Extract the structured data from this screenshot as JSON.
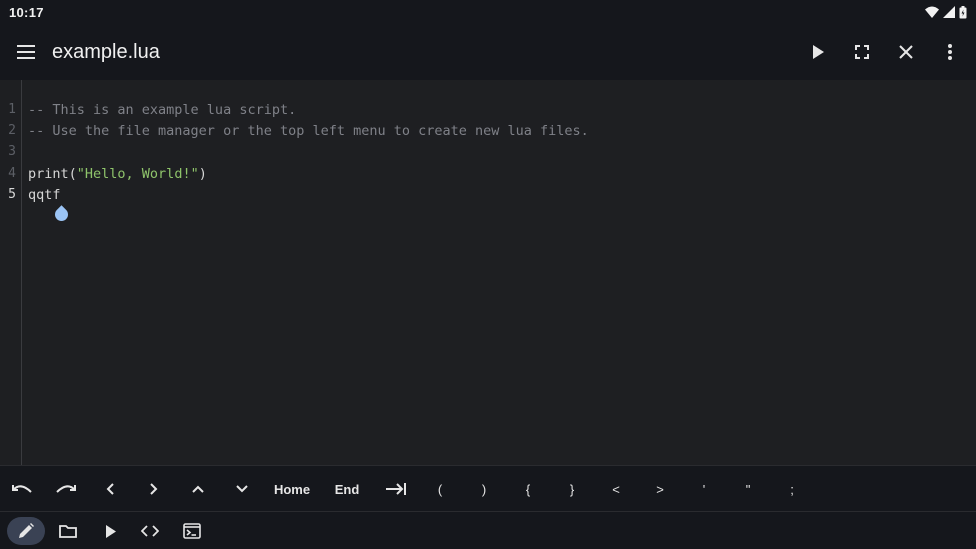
{
  "status": {
    "time": "10:17"
  },
  "appbar": {
    "title": "example.lua"
  },
  "editor": {
    "lines": [
      {
        "num": "1",
        "text": "-- This is an example lua script."
      },
      {
        "num": "2",
        "text": "-- Use the file manager or the top left menu to create new lua files."
      },
      {
        "num": "3",
        "text": ""
      },
      {
        "num": "4",
        "prefix": "print(",
        "string": "\"Hello, World!\"",
        "suffix": ")"
      },
      {
        "num": "5",
        "text": "qqtf"
      }
    ]
  },
  "keys": {
    "home": "Home",
    "end": "End",
    "paren_open": "(",
    "paren_close": ")",
    "brace_open": "{",
    "brace_close": "}",
    "lt": "<",
    "gt": ">",
    "single_quote": "'",
    "double_quote": "\"",
    "semicolon": ";"
  },
  "icons": {
    "menu": "menu-icon",
    "run": "play-icon",
    "fullscreen": "fullscreen-icon",
    "close": "close-icon",
    "more": "more-vert-icon"
  },
  "colors": {
    "background": "#1e1f22",
    "bar": "#15171c",
    "string": "#8fc46b",
    "comment": "#7f8188",
    "selected_nav": "#3a4254"
  }
}
